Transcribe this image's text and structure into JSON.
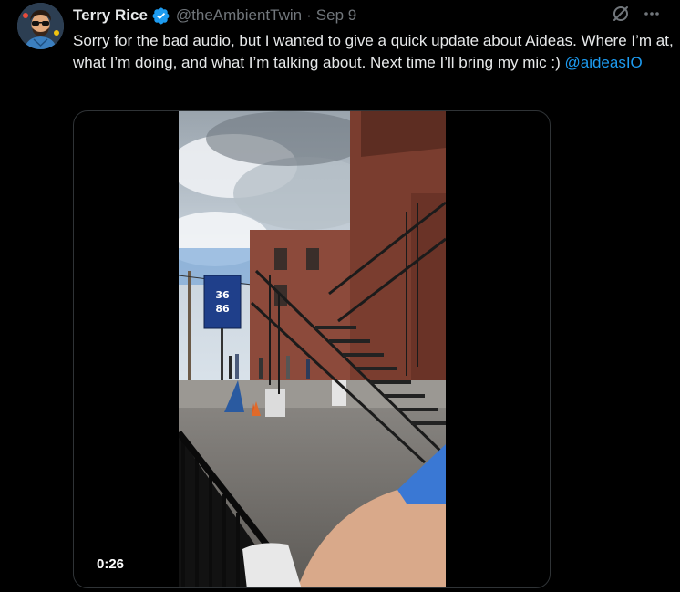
{
  "tweet": {
    "author": {
      "display_name": "Terry Rice",
      "handle": "@theAmbientTwin",
      "separator": "·",
      "timestamp": "Sep 9",
      "verified": true,
      "avatar_icon": "cartoon-avatar-with-sunglasses"
    },
    "text_parts": {
      "main": "Sorry for the bad audio, but I wanted to give a quick update about Aideas. Where I’m at, what I’m doing, and what I’m talking about. Next time I’ll bring my mic :) ",
      "mention": "@aideasIO"
    },
    "media": {
      "type": "video",
      "duration": "0:26",
      "banner_text": "36|86"
    },
    "actions": {
      "grok_icon": "grok-icon",
      "more_icon": "more-options-icon"
    },
    "colors": {
      "background": "#000000",
      "text": "#e7e9ea",
      "muted": "#71767b",
      "accent": "#1d9bf0"
    }
  }
}
